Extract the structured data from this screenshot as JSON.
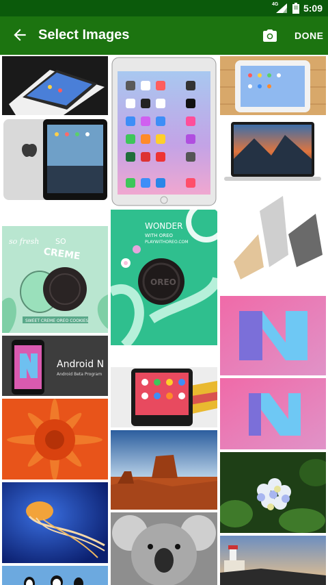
{
  "status_bar": {
    "network": "4G",
    "time": "5:09",
    "icons": [
      "signal-icon",
      "battery-icon"
    ]
  },
  "app_bar": {
    "title": "Select Images",
    "back_icon": "arrow-back-icon",
    "camera_icon": "camera-icon",
    "done_label": "DONE",
    "color": "#1c7410",
    "status_color": "#0b5a0b"
  },
  "images": {
    "oreo_cookie_text_1": "so fresh",
    "oreo_cookie_text_2": "SO",
    "oreo_cookie_text_3": "CREME",
    "oreo_cookie_caption": "SWEET CREME OREO COOKIES",
    "wonder_title": "WONDER",
    "wonder_sub": "WITH OREO",
    "wonder_url": "PLAYWITHOREO.COM",
    "cookie_brand": "OREO",
    "android_n_title": "Android N",
    "android_n_sub": "Android Beta Program"
  }
}
